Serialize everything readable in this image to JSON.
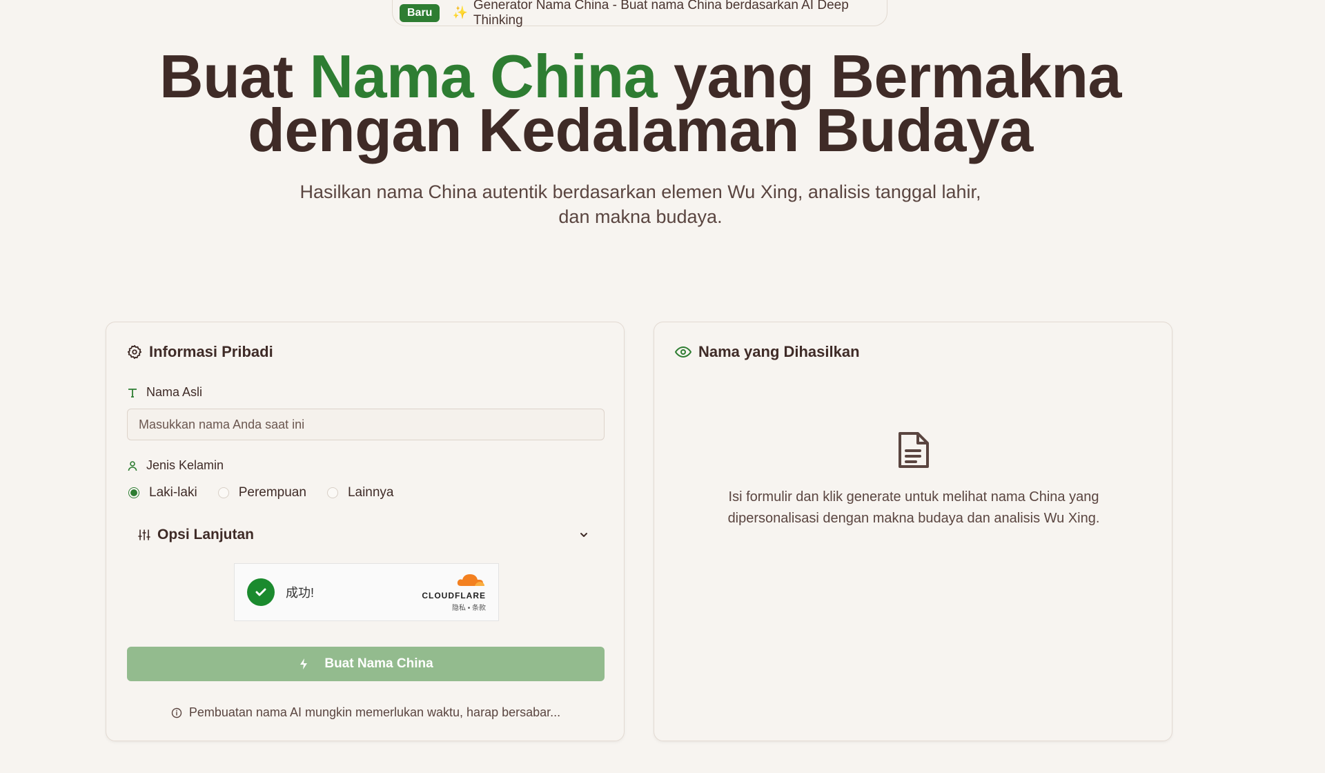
{
  "banner": {
    "badge": "Baru",
    "text": "Generator Nama China - Buat nama China berdasarkan AI Deep Thinking",
    "icon": "sparkle-icon"
  },
  "hero": {
    "title_part1": "Buat ",
    "title_accent": "Nama China",
    "title_part2": " yang Bermakna",
    "title_line2": "dengan Kedalaman Budaya",
    "subtitle": "Hasilkan nama China autentik berdasarkan elemen Wu Xing, analisis tanggal lahir, dan makna budaya."
  },
  "form": {
    "title": "Informasi Pribadi",
    "name_label": "Nama Asli",
    "name_placeholder": "Masukkan nama Anda saat ini",
    "name_value": "",
    "gender_label": "Jenis Kelamin",
    "gender_options": [
      "Laki-laki",
      "Perempuan",
      "Lainnya"
    ],
    "gender_selected": "Laki-laki",
    "advanced_label": "Opsi Lanjutan",
    "captcha": {
      "status": "成功!",
      "provider": "CLOUDFLARE",
      "links": "隐私 • 条款"
    },
    "submit_label": "Buat Nama China",
    "note": "Pembuatan nama AI mungkin memerlukan waktu, harap bersabar..."
  },
  "result": {
    "title": "Nama yang Dihasilkan",
    "empty_text": "Isi formulir dan klik generate untuk melihat nama China yang dipersonalisasi dengan makna budaya dan analisis Wu Xing."
  },
  "colors": {
    "accent": "#2e7d32",
    "text": "#3f2b27",
    "button": "#93bb8e",
    "background": "#f7f4f0"
  }
}
